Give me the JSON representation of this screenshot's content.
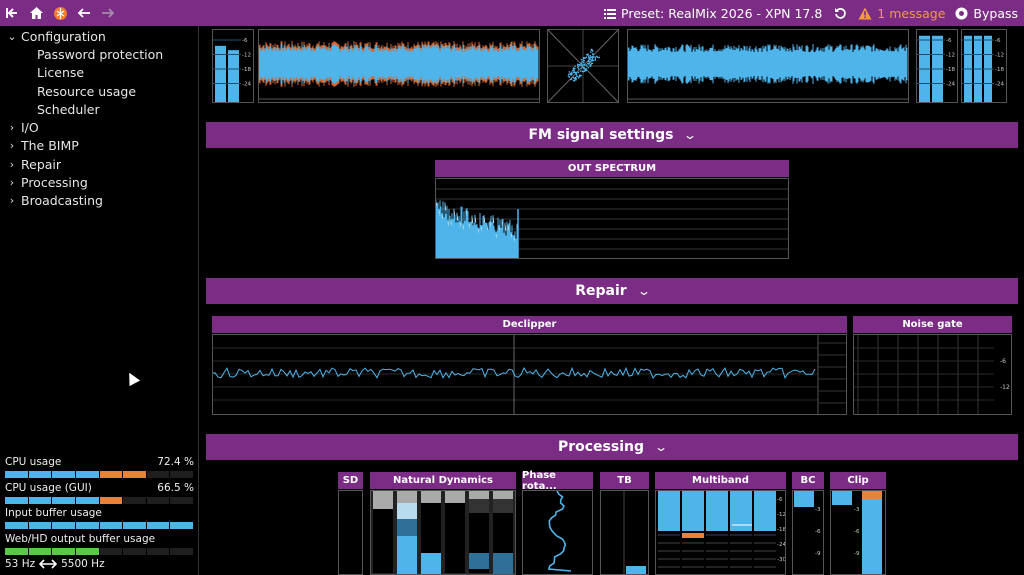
{
  "topbar": {
    "preset_label": "Preset: RealMix 2026 - XPN 17.8",
    "message_label": "1 message",
    "bypass_label": "Bypass"
  },
  "sidebar": {
    "items": [
      {
        "label": "Configuration",
        "expanded": true
      },
      {
        "label": "Password protection",
        "child": true
      },
      {
        "label": "License",
        "child": true
      },
      {
        "label": "Resource usage",
        "child": true
      },
      {
        "label": "Scheduler",
        "child": true
      },
      {
        "label": "I/O",
        "expanded": false
      },
      {
        "label": "The BIMP",
        "expanded": false
      },
      {
        "label": "Repair",
        "expanded": false
      },
      {
        "label": "Processing",
        "expanded": false
      },
      {
        "label": "Broadcasting",
        "expanded": false
      }
    ]
  },
  "meters": [
    {
      "label": "CPU usage",
      "value": "72.4 %",
      "fraction": 0.724,
      "color": "#4fb4ea",
      "peak_color": "#e8823a"
    },
    {
      "label": "CPU usage (GUI)",
      "value": "66.5 %",
      "fraction": 0.665,
      "color": "#4fb4ea",
      "peak_color": "#e8823a"
    },
    {
      "label": "Input buffer usage",
      "value": "",
      "fraction": 1.0,
      "color": "#4fb4ea"
    },
    {
      "label": "Web/HD output buffer usage",
      "value": "",
      "fraction": 0.5,
      "color": "#5cc84a"
    }
  ],
  "freq": {
    "low": "53 Hz",
    "high": "5500 Hz"
  },
  "sections": {
    "fm": "FM signal settings",
    "repair": "Repair",
    "processing": "Processing"
  },
  "panels": {
    "out_spectrum": "OUT SPECTRUM",
    "declipper": "Declipper",
    "noise_gate": "Noise gate",
    "sd": "SD",
    "natural_dynamics": "Natural Dynamics",
    "phase_rotator": "Phase rota...",
    "tb": "TB",
    "multiband": "Multiband",
    "bc": "BC",
    "clip": "Clip"
  },
  "scales": {
    "top": [
      "-6",
      "-12",
      "-18",
      "-24"
    ],
    "noise_gate": [
      "-6",
      "-12"
    ],
    "multiband": [
      "-6",
      "-12",
      "-18",
      "-24",
      "-30"
    ],
    "bc": [
      "-3",
      "-6",
      "-9"
    ],
    "clip": [
      "-3",
      "-6",
      "-9"
    ]
  },
  "colors": {
    "accent": "#7b2d86",
    "meter_blue": "#4fb4ea",
    "meter_orange": "#e8823a",
    "warn": "#f39a3a"
  }
}
